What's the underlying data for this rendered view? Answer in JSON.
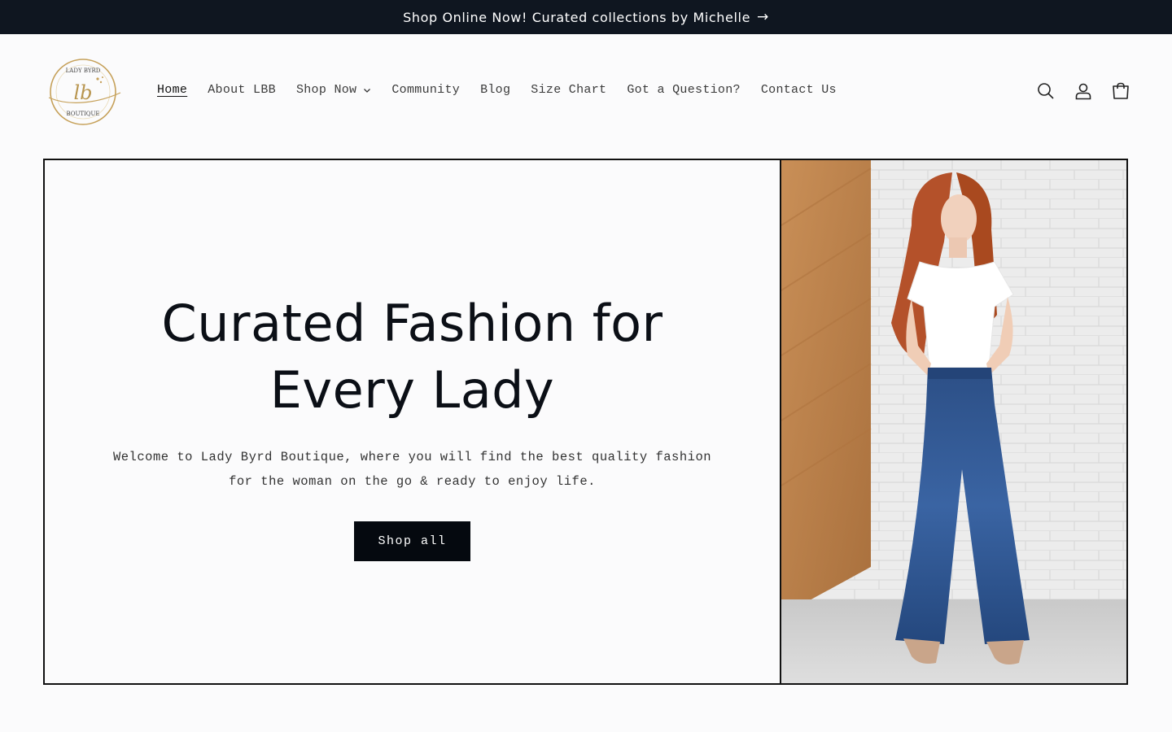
{
  "announcement": {
    "text": "Shop Online Now! Curated collections by Michelle"
  },
  "logo": {
    "alt": "Lady Byrd Boutique logo",
    "top_text": "LADY BYRD",
    "bottom_text": "BOUTIQUE",
    "monogram": "lb"
  },
  "nav": {
    "items": [
      {
        "label": "Home"
      },
      {
        "label": "About LBB"
      },
      {
        "label": "Shop Now"
      },
      {
        "label": "Community"
      },
      {
        "label": "Blog"
      },
      {
        "label": "Size Chart"
      },
      {
        "label": "Got a Question?"
      },
      {
        "label": "Contact Us"
      }
    ],
    "active": "Home"
  },
  "header_icons": [
    "search-icon",
    "account-icon",
    "cart-icon"
  ],
  "hero": {
    "title": "Curated Fashion for Every Lady",
    "subtitle": "Welcome to Lady Byrd Boutique, where you will find the best quality fashion for the woman on the go & ready to enjoy life.",
    "cta_label": "Shop all",
    "image_alt": "Model in white tee and wide-leg jeans"
  },
  "colors": {
    "announcement_bg": "#0f1620",
    "button_bg": "#05090f",
    "logo_gold": "#c6a15a"
  }
}
